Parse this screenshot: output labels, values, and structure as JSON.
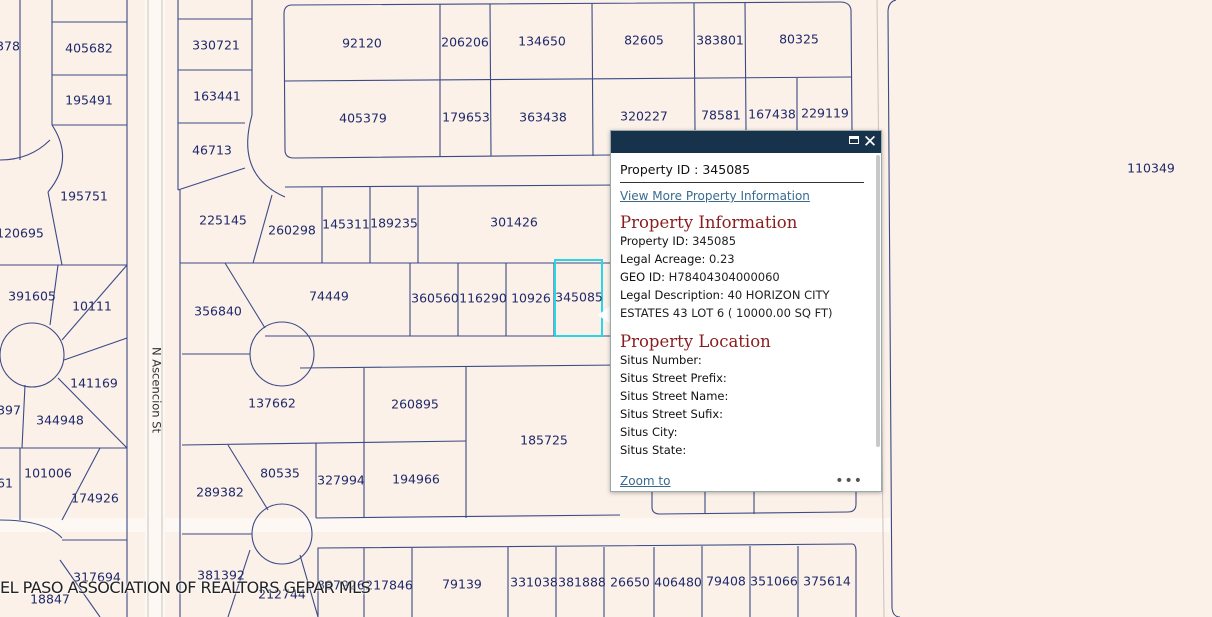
{
  "street_name": "N Ascencion St",
  "watermark": "EL PASO ASSOCIATION OF REALTORS GEPAR MLS",
  "parcels": [
    "378",
    "405682",
    "195491",
    "195751",
    "120695",
    "391605",
    "10111",
    "141169",
    "397",
    "344948",
    "101006",
    "174926",
    "61",
    "317694",
    "18847",
    "330721",
    "163441",
    "46713",
    "225145",
    "260298",
    "145311",
    "189235",
    "301426",
    "356840",
    "74449",
    "360560",
    "116290",
    "10926",
    "345085",
    "137662",
    "260895",
    "185725",
    "289382",
    "80535",
    "327994",
    "194966",
    "381392",
    "212744",
    "387926",
    "217846",
    "79139",
    "331038",
    "381888",
    "26650",
    "406480",
    "79408",
    "351066",
    "375614",
    "92120",
    "206206",
    "134650",
    "82605",
    "383801",
    "80325",
    "405379",
    "179653",
    "363438",
    "320227",
    "78581",
    "167438",
    "229119",
    "110349"
  ],
  "popup": {
    "title": "Property ID : 345085",
    "more_link": "View More Property Information",
    "sections": [
      {
        "heading": "Property Information",
        "fields": [
          {
            "k": "Property ID:",
            "v": "345085"
          },
          {
            "k": "Legal Acreage:",
            "v": "0.23"
          },
          {
            "k": "GEO ID:",
            "v": "H78404304000060"
          },
          {
            "k": "Legal Description:",
            "v": "40 HORIZON CITY ESTATES 43 LOT 6 ( 10000.00 SQ FT)"
          }
        ]
      },
      {
        "heading": "Property Location",
        "fields": [
          {
            "k": "Situs Number:",
            "v": ""
          },
          {
            "k": "Situs Street Prefix:",
            "v": ""
          },
          {
            "k": "Situs Street Name:",
            "v": ""
          },
          {
            "k": "Situs Street Sufix:",
            "v": ""
          },
          {
            "k": "Situs City:",
            "v": ""
          },
          {
            "k": "Situs State:",
            "v": ""
          }
        ]
      }
    ],
    "zoom_label": "Zoom to",
    "more_menu": "•••"
  },
  "colors": {
    "background": "#fbf1e9",
    "parcel_line": "#3c4a86",
    "label": "#1f2a6b",
    "highlight": "#29d6e6",
    "popup_header": "#17334b",
    "section_heading": "#8a1c1c",
    "link": "#3b6a8e"
  }
}
